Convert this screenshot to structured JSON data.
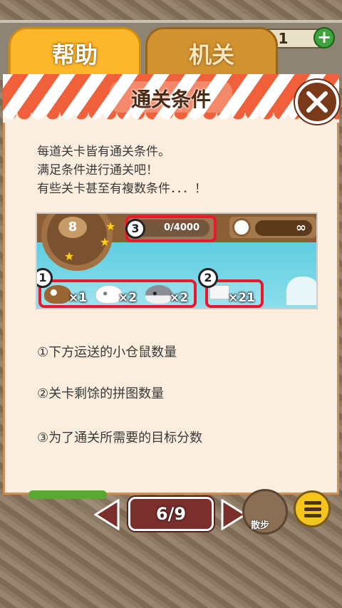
{
  "tabs": {
    "help_label": "帮助",
    "switch_label": "机关"
  },
  "topbar": {
    "counter_value": "1"
  },
  "panel": {
    "title": "通关条件",
    "description": [
      "每道关卡皆有通关条件。",
      "满足条件进行通关吧！",
      "有些关卡甚至有複数条件．．．！"
    ],
    "legend": [
      "①下方运送的小仓鼠数量",
      "②关卡剩馀的拼图数量",
      "③为了通关所需要的目标分数"
    ]
  },
  "example": {
    "level_number": "8",
    "score_text": "0/4000",
    "timer_text": "∞",
    "badge_1": "1",
    "badge_2": "2",
    "badge_3": "3",
    "hamster_brown_count": "×1",
    "hamster_white_count": "×2",
    "hamster_gray_count": "×2",
    "puzzle_count": "×21"
  },
  "footer": {
    "page_indicator": "6/9",
    "walk_label": "散步"
  },
  "colors": {
    "tab_active": "#fcb72a",
    "tab_inactive": "#d19230",
    "highlight_red": "#e8192c",
    "close_button": "#7a3a1a",
    "page_box": "#7a2f2c"
  },
  "icons": [
    "close-icon",
    "plus-icon",
    "clock-icon",
    "star-icon",
    "arrow-left-icon",
    "arrow-right-icon",
    "menu-icon",
    "hamster-icon",
    "puzzle-icon"
  ]
}
